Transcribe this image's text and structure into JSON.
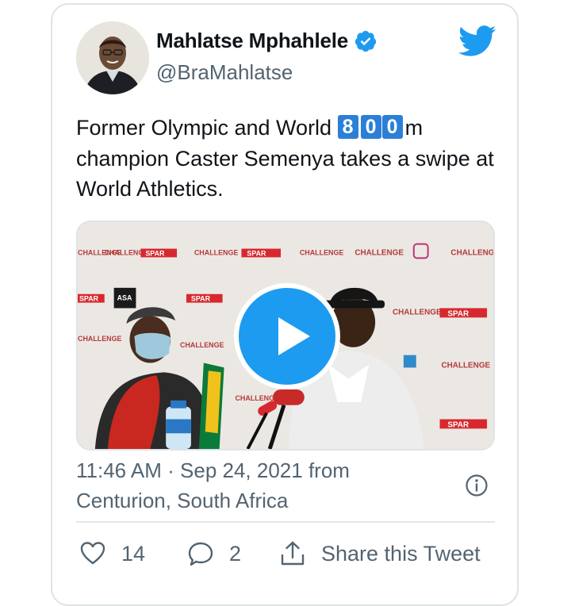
{
  "author": {
    "name": "Mahlatse Mphahlele",
    "handle": "@BraMahlatse",
    "verified_icon": "verified-badge-icon",
    "avatar": "profile-photo"
  },
  "brand": {
    "icon": "twitter-bird-icon",
    "color": "#1d9bf0"
  },
  "tweet": {
    "text_before": "Former Olympic and World ",
    "highlight_digits": [
      "8",
      "0",
      "0"
    ],
    "text_after": "m champion Caster Semenya takes a swipe at World Athletics."
  },
  "media": {
    "type": "video",
    "play_icon": "play-icon",
    "backdrop_text": {
      "challenge": "CHALLENGE",
      "spar": "SPAR",
      "asa": "ASA"
    }
  },
  "meta": {
    "timestamp": "11:46 AM · Sep 24, 2021 from",
    "location": "Centurion, South Africa",
    "info_icon": "info-icon"
  },
  "actions": {
    "likes": "14",
    "replies": "2",
    "share_label": "Share this Tweet"
  },
  "colors": {
    "text": "#0f1419",
    "secondary": "#536471",
    "accent": "#1d9bf0",
    "digit_bg": "#2b7fd6",
    "border": "#dfe3e6"
  }
}
